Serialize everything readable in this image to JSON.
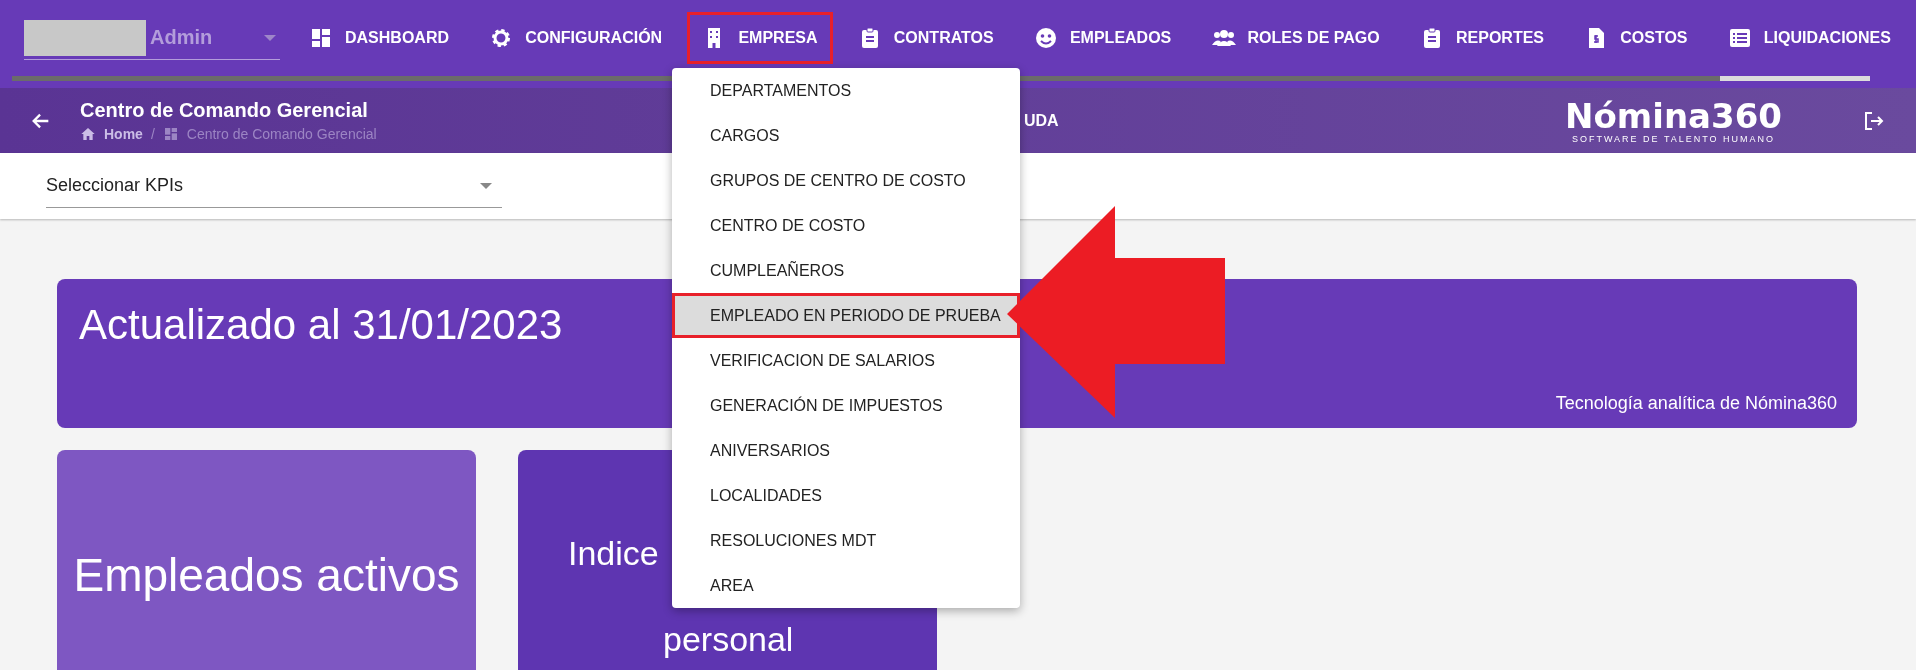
{
  "user": {
    "role": "Admin"
  },
  "nav": [
    {
      "label": "DASHBOARD",
      "highlighted": false
    },
    {
      "label": "CONFIGURACIÓN",
      "highlighted": false
    },
    {
      "label": "EMPRESA",
      "highlighted": true
    },
    {
      "label": "CONTRATOS",
      "highlighted": false
    },
    {
      "label": "EMPLEADOS",
      "highlighted": false
    },
    {
      "label": "ROLES DE PAGO",
      "highlighted": false
    },
    {
      "label": "REPORTES",
      "highlighted": false
    },
    {
      "label": "COSTOS",
      "highlighted": false
    },
    {
      "label": "LIQUIDACIONES",
      "highlighted": false
    }
  ],
  "header": {
    "title": "Centro de Comando Gerencial",
    "breadcrumb": [
      "Home",
      "Centro de Comando Gerencial"
    ],
    "breadcrumb_separator": "/",
    "help_link": "UDA",
    "logo": {
      "name": "Nómina360",
      "tagline": "SOFTWARE DE TALENTO HUMANO"
    }
  },
  "kpi_select": {
    "placeholder": "Seleccionar KPIs"
  },
  "banner": {
    "title": "Actualizado al 31/01/2023",
    "footer": "Tecnología analítica de Nómina360"
  },
  "cards": [
    {
      "lines": [
        "Empleados activos"
      ],
      "color": "#7e57c2"
    },
    {
      "lines": [
        "Indice",
        "personal"
      ],
      "color": "#5e35b1"
    }
  ],
  "menu": {
    "items": [
      {
        "label": "DEPARTAMENTOS",
        "selected": false,
        "highlighted": false
      },
      {
        "label": "CARGOS",
        "selected": false,
        "highlighted": false
      },
      {
        "label": "GRUPOS DE CENTRO DE COSTO",
        "selected": false,
        "highlighted": false
      },
      {
        "label": "CENTRO DE COSTO",
        "selected": false,
        "highlighted": false
      },
      {
        "label": "CUMPLEAÑEROS",
        "selected": false,
        "highlighted": false
      },
      {
        "label": "EMPLEADO EN PERIODO DE PRUEBA",
        "selected": true,
        "highlighted": true
      },
      {
        "label": "VERIFICACION DE SALARIOS",
        "selected": false,
        "highlighted": false
      },
      {
        "label": "GENERACIÓN DE IMPUESTOS",
        "selected": false,
        "highlighted": false
      },
      {
        "label": "ANIVERSARIOS",
        "selected": false,
        "highlighted": false
      },
      {
        "label": "LOCALIDADES",
        "selected": false,
        "highlighted": false
      },
      {
        "label": "RESOLUCIONES MDT",
        "selected": false,
        "highlighted": false
      },
      {
        "label": "AREA",
        "selected": false,
        "highlighted": false
      }
    ]
  }
}
